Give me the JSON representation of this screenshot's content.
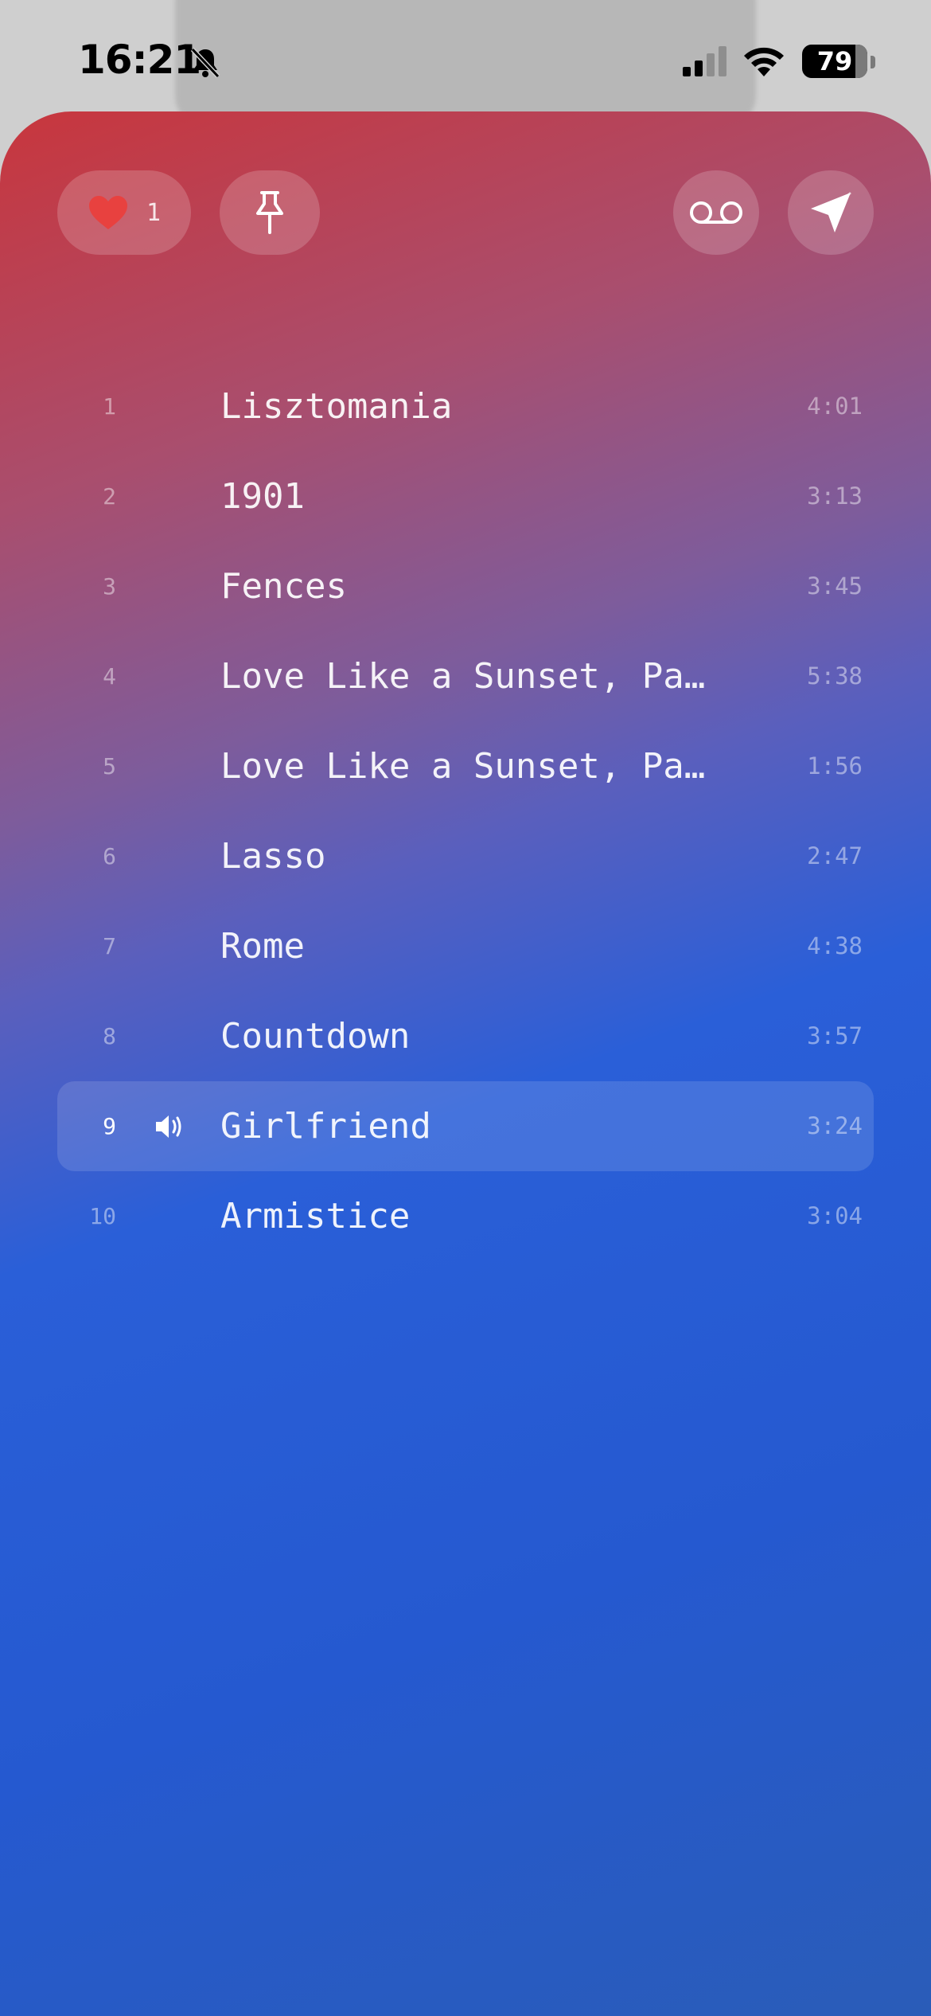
{
  "status_bar": {
    "time": "16:21",
    "battery": "79",
    "battery_level": 0.79,
    "icons": [
      "bell-slash-icon",
      "cellular-signal-icon",
      "wifi-icon",
      "battery-icon"
    ]
  },
  "toolbar": {
    "like_count": "1",
    "like_icon": "heart-icon",
    "pin_icon": "pin-icon",
    "voicemail_icon": "voicemail-icon",
    "send_icon": "send-icon"
  },
  "colors": {
    "heart": "#e8413f",
    "gradient_top": "#c8363d",
    "gradient_bottom": "#2559d0"
  },
  "tracks": [
    {
      "num": "1",
      "title": "Lisztomania",
      "duration": "4:01"
    },
    {
      "num": "2",
      "title": "1901",
      "duration": "3:13"
    },
    {
      "num": "3",
      "title": "Fences",
      "duration": "3:45"
    },
    {
      "num": "4",
      "title": "Love Like a Sunset, Pa…",
      "duration": "5:38"
    },
    {
      "num": "5",
      "title": "Love Like a Sunset, Pa…",
      "duration": "1:56"
    },
    {
      "num": "6",
      "title": "Lasso",
      "duration": "2:47"
    },
    {
      "num": "7",
      "title": "Rome",
      "duration": "4:38"
    },
    {
      "num": "8",
      "title": "Countdown",
      "duration": "3:57"
    },
    {
      "num": "9",
      "title": "Girlfriend",
      "duration": "3:24",
      "playing": true
    },
    {
      "num": "10",
      "title": "Armistice",
      "duration": "3:04"
    }
  ]
}
